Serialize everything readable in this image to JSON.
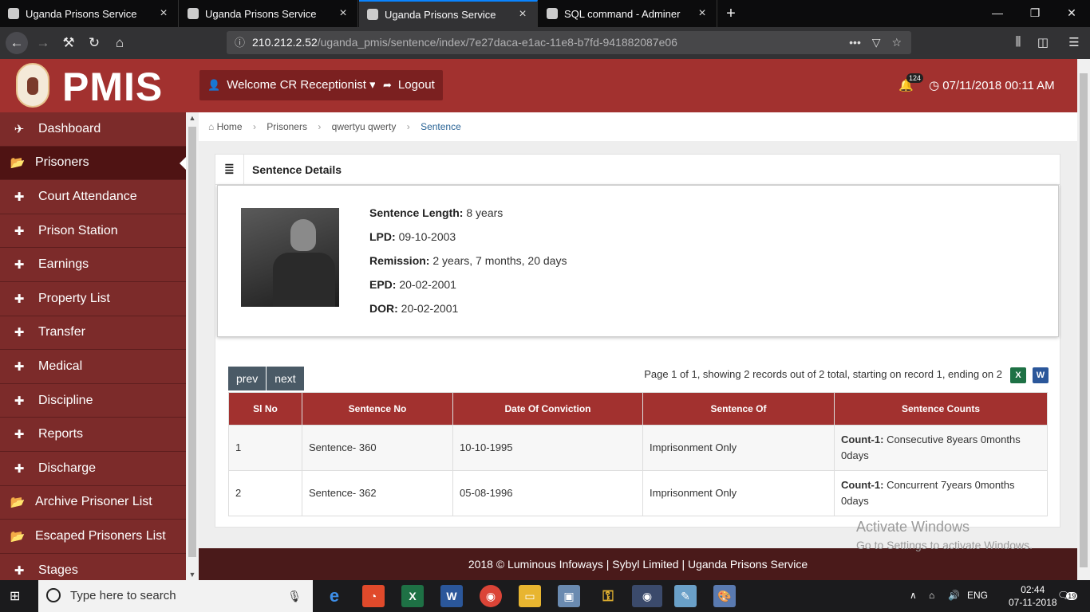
{
  "browser": {
    "tabs": [
      {
        "label": "Uganda Prisons Service"
      },
      {
        "label": "Uganda Prisons Service"
      },
      {
        "label": "Uganda Prisons Service"
      },
      {
        "label": "SQL command - Adminer"
      }
    ],
    "url_host": "210.212.2.52",
    "url_path": "/uganda_pmis/sentence/index/7e27daca-e1ac-11e8-b7fd-941882087e06"
  },
  "header": {
    "logo_text": "PMIS",
    "welcome": "Welcome CR Receptionist",
    "logout": "Logout",
    "notif_count": "124",
    "datetime": "07/11/2018 00:11 AM"
  },
  "sidebar": {
    "items": [
      {
        "label": "Dashboard"
      },
      {
        "label": "Prisoners"
      },
      {
        "label": "Court Attendance"
      },
      {
        "label": "Prison Station"
      },
      {
        "label": "Earnings"
      },
      {
        "label": "Property List"
      },
      {
        "label": "Transfer"
      },
      {
        "label": "Medical"
      },
      {
        "label": "Discipline"
      },
      {
        "label": "Reports"
      },
      {
        "label": "Discharge"
      },
      {
        "label": "Archive Prisoner List"
      },
      {
        "label": "Escaped Prisoners List"
      },
      {
        "label": "Stages"
      }
    ]
  },
  "breadcrumb": [
    "Home",
    "Prisoners",
    "qwertyu qwerty",
    "Sentence"
  ],
  "panel": {
    "title": "Sentence Details",
    "details": [
      {
        "label": "Sentence Length:",
        "value": "8 years"
      },
      {
        "label": "LPD:",
        "value": "09-10-2003"
      },
      {
        "label": "Remission:",
        "value": "2 years, 7 months, 20 days"
      },
      {
        "label": "EPD:",
        "value": "20-02-2001"
      },
      {
        "label": "DOR:",
        "value": "20-02-2001"
      }
    ]
  },
  "pager": {
    "prev": "prev",
    "next": "next",
    "info": "Page 1 of 1, showing 2 records out of 2 total, starting on record 1, ending on 2"
  },
  "table": {
    "headers": [
      "Sl No",
      "Sentence No",
      "Date Of Conviction",
      "Sentence Of",
      "Sentence Counts"
    ],
    "rows": [
      {
        "sl": "1",
        "no": "Sentence- 360",
        "date": "10-10-1995",
        "of": "Imprisonment Only",
        "count_label": "Count-1:",
        "count_value": "Consecutive 8years 0months 0days"
      },
      {
        "sl": "2",
        "no": "Sentence- 362",
        "date": "05-08-1996",
        "of": "Imprisonment Only",
        "count_label": "Count-1:",
        "count_value": "Concurrent 7years 0months 0days"
      }
    ]
  },
  "footer": "2018 © Luminous Infoways  |  Sybyl Limited  |  Uganda Prisons Service",
  "watermark": {
    "title": "Activate Windows",
    "sub": "Go to Settings to activate Windows."
  },
  "taskbar": {
    "search_placeholder": "Type here to search",
    "lang": "ENG",
    "time": "02:44",
    "date": "07-11-2018",
    "notif": "19"
  }
}
